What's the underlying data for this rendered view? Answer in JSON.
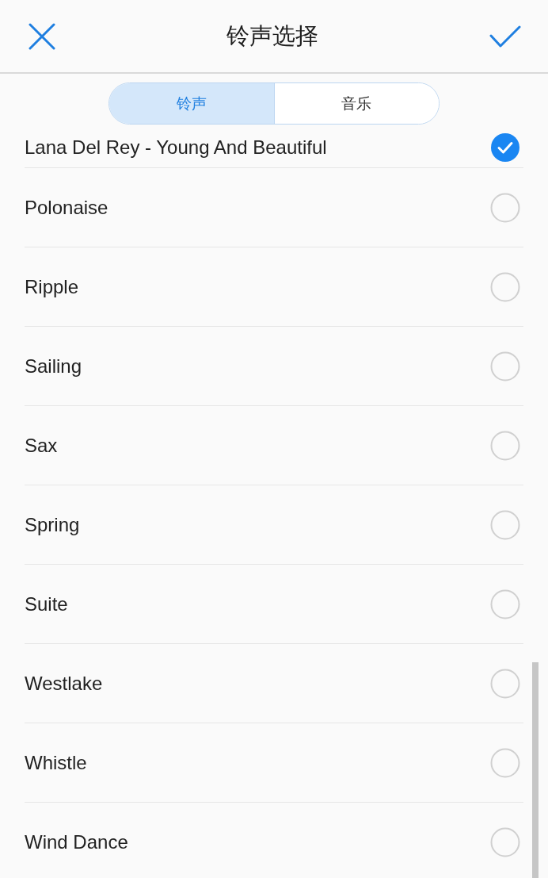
{
  "header": {
    "title": "铃声选择"
  },
  "tabs": [
    {
      "label": "铃声",
      "selected": true
    },
    {
      "label": "音乐",
      "selected": false
    }
  ],
  "ringtones": [
    {
      "name": "Lana Del Rey - Young And Beautiful",
      "selected": true
    },
    {
      "name": "Polonaise",
      "selected": false
    },
    {
      "name": "Ripple",
      "selected": false
    },
    {
      "name": "Sailing",
      "selected": false
    },
    {
      "name": "Sax",
      "selected": false
    },
    {
      "name": "Spring",
      "selected": false
    },
    {
      "name": "Suite",
      "selected": false
    },
    {
      "name": "Westlake",
      "selected": false
    },
    {
      "name": "Whistle",
      "selected": false
    },
    {
      "name": "Wind Dance",
      "selected": false
    }
  ]
}
